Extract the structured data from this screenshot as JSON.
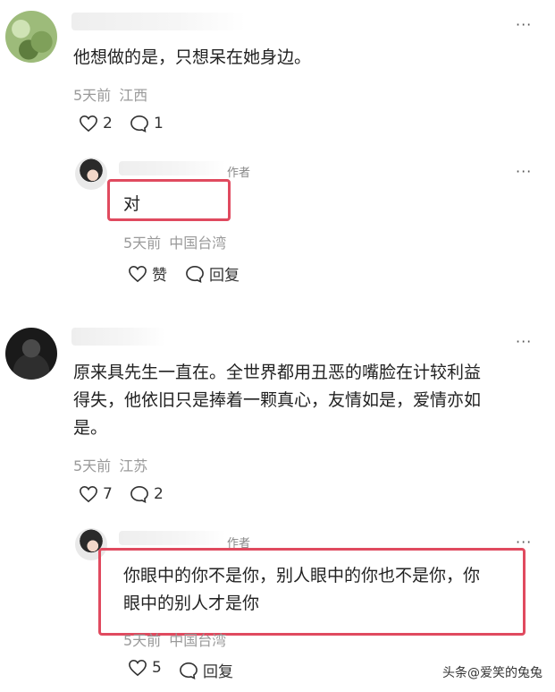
{
  "comments": [
    {
      "text": "他想做的是，只想呆在她身边。",
      "time": "5天前",
      "location": "江西",
      "likes": "2",
      "replies": "1",
      "reply": {
        "author_tag": "作者",
        "text": "对",
        "time": "5天前",
        "location": "中国台湾",
        "like_label": "赞",
        "reply_label": "回复"
      }
    },
    {
      "text_lines": [
        "原来具先生一直在。全世界都用丑恶的嘴脸在计较利益",
        "得失，他依旧只是捧着一颗真心，友情如是，爱情亦如",
        "是。"
      ],
      "time": "5天前",
      "location": "江苏",
      "likes": "7",
      "replies": "2",
      "reply": {
        "author_tag": "作者",
        "text_lines": [
          "你眼中的你不是你，别人眼中的你也不是你，你",
          "眼中的别人才是你"
        ],
        "time": "5天前",
        "location": "中国台湾",
        "likes": "5",
        "reply_label": "回复"
      }
    }
  ],
  "more_icon": "more-icon",
  "highlight_color": "#e04a5f",
  "watermark": "头条@爱笑的兔兔"
}
